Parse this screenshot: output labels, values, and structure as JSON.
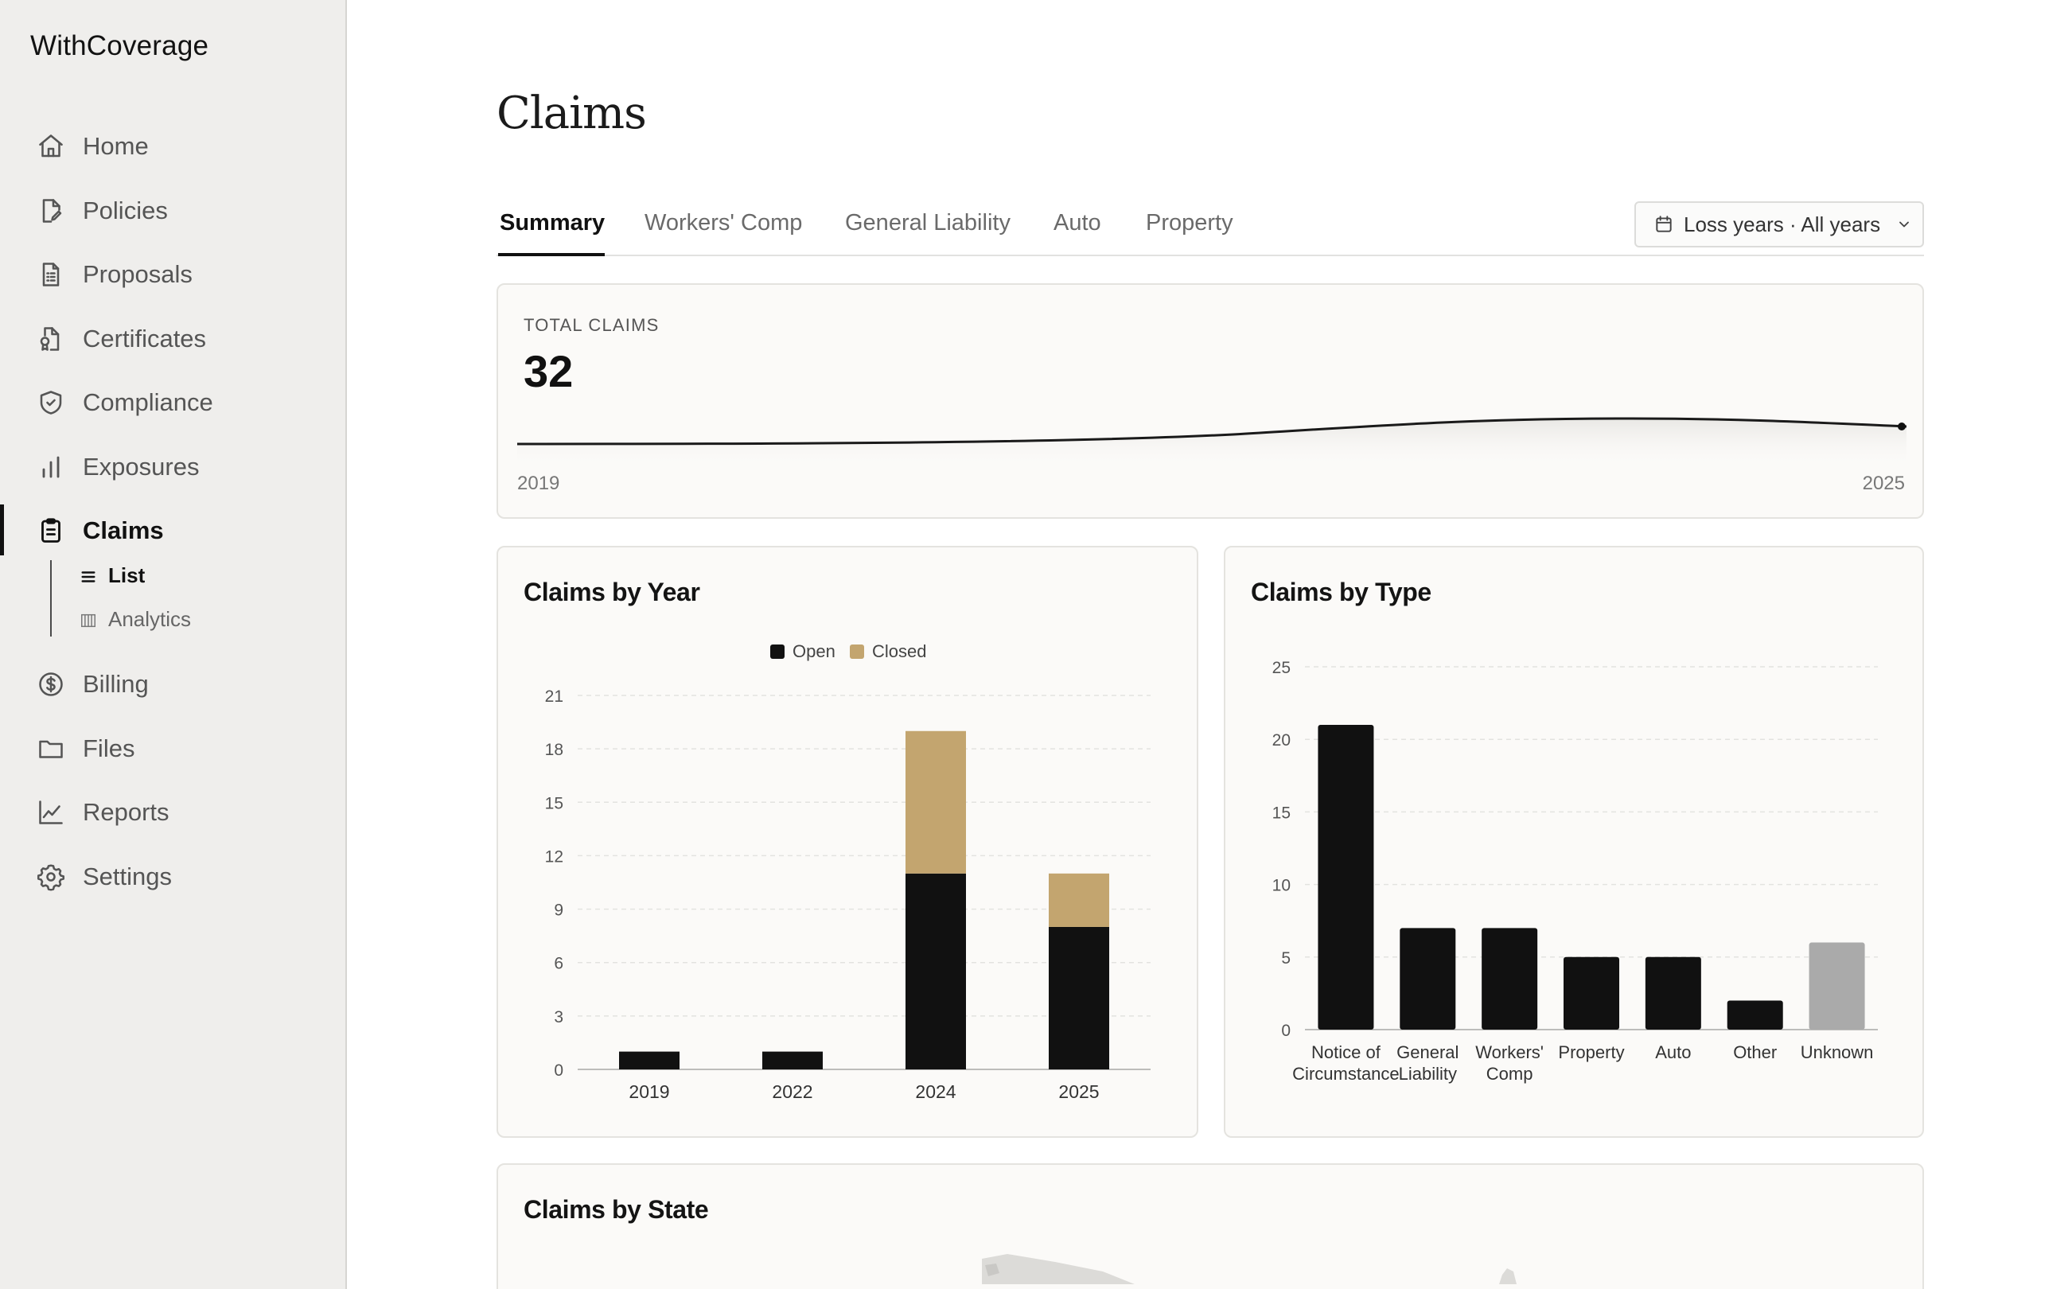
{
  "app": {
    "brand": "WithCoverage"
  },
  "sidebar": {
    "items": [
      {
        "label": "Home",
        "icon": "home-icon"
      },
      {
        "label": "Policies",
        "icon": "file-pen-icon"
      },
      {
        "label": "Proposals",
        "icon": "document-list-icon"
      },
      {
        "label": "Certificates",
        "icon": "certificate-icon"
      },
      {
        "label": "Compliance",
        "icon": "shield-check-icon"
      },
      {
        "label": "Exposures",
        "icon": "bar-chart-icon"
      },
      {
        "label": "Claims",
        "icon": "clipboard-icon",
        "active": true
      },
      {
        "label": "Billing",
        "icon": "dollar-circle-icon"
      },
      {
        "label": "Files",
        "icon": "folder-icon"
      },
      {
        "label": "Reports",
        "icon": "line-chart-icon"
      },
      {
        "label": "Settings",
        "icon": "gear-icon"
      }
    ],
    "claims_sub": [
      {
        "label": "List",
        "icon": "list-icon",
        "active": true
      },
      {
        "label": "Analytics",
        "icon": "columns-icon"
      }
    ]
  },
  "page": {
    "title": "Claims",
    "tabs": [
      {
        "label": "Summary",
        "active": true
      },
      {
        "label": "Workers' Comp"
      },
      {
        "label": "General Liability"
      },
      {
        "label": "Auto"
      },
      {
        "label": "Property"
      }
    ],
    "filter_label": "Loss years · All years"
  },
  "total_claims": {
    "label": "TOTAL CLAIMS",
    "value": "32",
    "start_label": "2019",
    "end_label": "2025"
  },
  "colors": {
    "open": "#111111",
    "closed": "#c3a56f",
    "unknown": "#aaaaaa",
    "grid": "#e3e3e0",
    "axis": "#bdbdbb",
    "tick": "#555555"
  },
  "chart_data": [
    {
      "id": "claims-by-year",
      "type": "bar",
      "title": "Claims by Year",
      "stacked": true,
      "categories": [
        "2019",
        "2022",
        "2024",
        "2025"
      ],
      "series": [
        {
          "name": "Open",
          "values": [
            1,
            1,
            11,
            8
          ]
        },
        {
          "name": "Closed",
          "values": [
            0,
            0,
            8,
            3
          ]
        }
      ],
      "yticks": [
        0,
        3,
        6,
        9,
        12,
        15,
        18,
        21
      ],
      "ylim": [
        0,
        21
      ],
      "legend": "top-center",
      "grid": true
    },
    {
      "id": "claims-by-type",
      "type": "bar",
      "title": "Claims by Type",
      "categories": [
        "Notice of Circumstance",
        "General Liability",
        "Workers' Comp",
        "Property",
        "Auto",
        "Other",
        "Unknown"
      ],
      "category_lines": [
        [
          "Notice of",
          "Circumstance"
        ],
        [
          "General",
          "Liability"
        ],
        [
          "Workers'",
          "Comp"
        ],
        [
          "Property"
        ],
        [
          "Auto"
        ],
        [
          "Other"
        ],
        [
          "Unknown"
        ]
      ],
      "values": [
        21,
        7,
        7,
        5,
        5,
        2,
        6
      ],
      "yticks": [
        0,
        5,
        10,
        15,
        20,
        25
      ],
      "ylim": [
        0,
        25
      ],
      "grid": true
    }
  ],
  "claims_by_state": {
    "title": "Claims by State"
  }
}
